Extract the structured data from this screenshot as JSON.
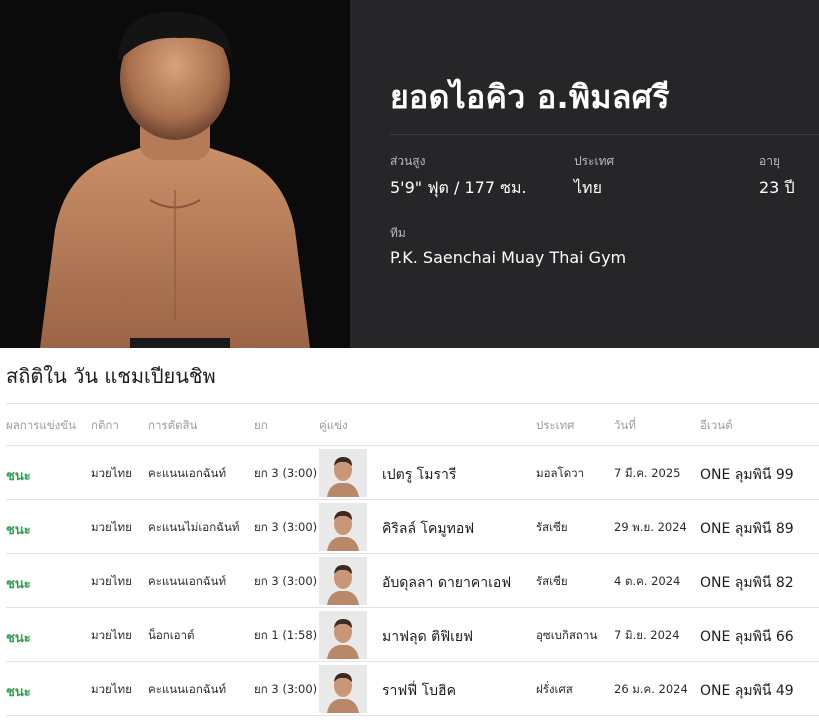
{
  "fighter": {
    "name": "ยอดไอคิว อ.พิมลศรี",
    "height_label": "ส่วนสูง",
    "height_value": "5'9\" ฟุต / 177 ซม.",
    "country_label": "ประเทศ",
    "country_value": "ไทย",
    "age_label": "อายุ",
    "age_value": "23 ปี",
    "team_label": "ทีม",
    "team_value": "P.K. Saenchai Muay Thai Gym"
  },
  "stats": {
    "title": "สถิติใน วัน แชมเปียนชิพ",
    "headers": {
      "result": "ผลการแข่งขัน",
      "rule": "กติกา",
      "method": "การตัดสิน",
      "round": "ยก",
      "opponent": "คู่แข่ง",
      "country": "ประเทศ",
      "date": "วันที่",
      "event": "อีเวนต์"
    },
    "rows": [
      {
        "result": "ชนะ",
        "rule": "มวยไทย",
        "method": "คะแนนเอกฉันท์",
        "round": "ยก 3 (3:00)",
        "opponent": "เปตรู โมรารี",
        "country": "มอลโดวา",
        "date": "7 มี.ค. 2025",
        "event": "ONE ลุมพินี 99"
      },
      {
        "result": "ชนะ",
        "rule": "มวยไทย",
        "method": "คะแนนไม่เอกฉันท์",
        "round": "ยก 3 (3:00)",
        "opponent": "คิริลล์ โคมูทอฟ",
        "country": "รัสเซีย",
        "date": "29 พ.ย. 2024",
        "event": "ONE ลุมพินี 89"
      },
      {
        "result": "ชนะ",
        "rule": "มวยไทย",
        "method": "คะแนนเอกฉันท์",
        "round": "ยก 3 (3:00)",
        "opponent": "อับดุลลา ดายาคาเอฟ",
        "country": "รัสเซีย",
        "date": "4 ต.ค. 2024",
        "event": "ONE ลุมพินี 82"
      },
      {
        "result": "ชนะ",
        "rule": "มวยไทย",
        "method": "น็อกเอาต์",
        "round": "ยก 1 (1:58)",
        "opponent": "มาฟลุด ติฟิเยฟ",
        "country": "อุซเบกิสถาน",
        "date": "7 มิ.ย. 2024",
        "event": "ONE ลุมพินี 66"
      },
      {
        "result": "ชนะ",
        "rule": "มวยไทย",
        "method": "คะแนนเอกฉันท์",
        "round": "ยก 3 (3:00)",
        "opponent": "ราฟฟี่ โบฮิค",
        "country": "ฝรั่งเศส",
        "date": "26 ม.ค. 2024",
        "event": "ONE ลุมพินี 49"
      }
    ]
  }
}
